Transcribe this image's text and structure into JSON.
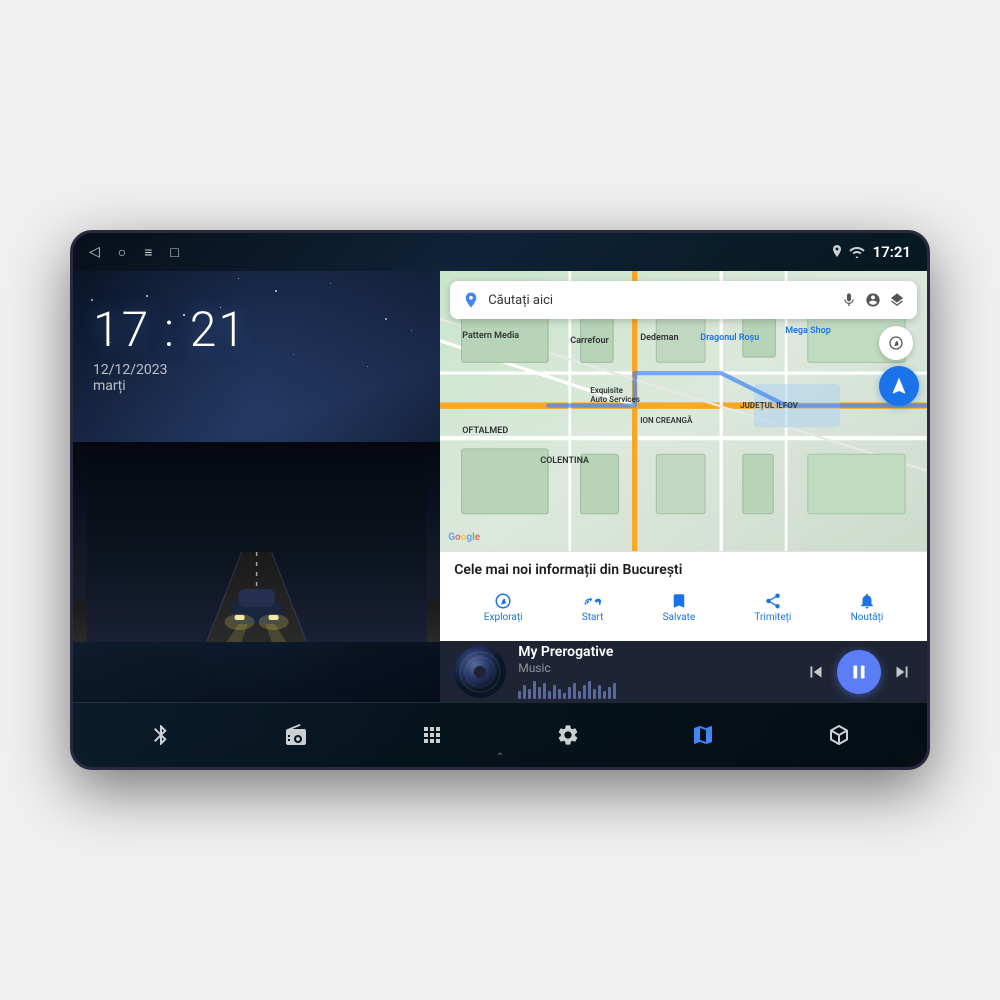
{
  "device": {
    "status_bar": {
      "time": "17:21",
      "wifi_icon": "wifi",
      "location_icon": "location",
      "nav_back": "◁",
      "nav_home": "○",
      "nav_menu": "≡",
      "nav_screenshot": "□"
    }
  },
  "left_panel": {
    "clock_time": "17 : 21",
    "date": "12/12/2023",
    "day": "marți"
  },
  "map": {
    "search_placeholder": "Căutați aici",
    "info_title": "Cele mai noi informații din București",
    "tabs": [
      {
        "label": "Explorați",
        "icon": "🔍"
      },
      {
        "label": "Start",
        "icon": "🚌"
      },
      {
        "label": "Salvate",
        "icon": "🔖"
      },
      {
        "label": "Trimiteți",
        "icon": "⏱"
      },
      {
        "label": "Noutăți",
        "icon": "🔔"
      }
    ],
    "labels": [
      "Pattern Media",
      "Carrefour",
      "Dragonul Roșu",
      "Dedeman",
      "Exquisite Auto Services",
      "OFTALMED",
      "ION CREANGĂ",
      "JUDEȚUL ILFOV",
      "COLENTINA",
      "Mega Shop"
    ]
  },
  "music": {
    "title": "My Prerogative",
    "subtitle": "Music",
    "prev_icon": "⏮",
    "play_icon": "⏸",
    "next_icon": "⏭"
  },
  "bottom_nav": {
    "items": [
      {
        "name": "bluetooth",
        "icon": "bluetooth"
      },
      {
        "name": "radio",
        "icon": "radio"
      },
      {
        "name": "apps",
        "icon": "apps"
      },
      {
        "name": "settings",
        "icon": "settings"
      },
      {
        "name": "maps",
        "icon": "maps"
      },
      {
        "name": "carplay",
        "icon": "carplay"
      }
    ]
  }
}
